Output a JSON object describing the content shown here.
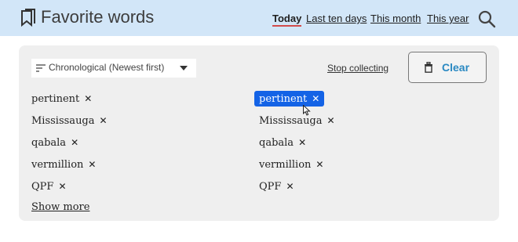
{
  "header": {
    "title": "Favorite words",
    "nav": [
      "Today",
      "Last ten days",
      "This month",
      "This year"
    ],
    "active_nav": "Today",
    "logo_icon": "bookmark-icon",
    "search_icon": "search-icon"
  },
  "controls": {
    "sort_label": "Chronological (Newest first)",
    "stop_label": "Stop collecting",
    "clear_label": "Clear"
  },
  "lists": {
    "left": [
      "pertinent",
      "Mississauga",
      "qabala",
      "vermillion",
      "QPF"
    ],
    "right": [
      "pertinent",
      "Mississauga",
      "qabala",
      "vermillion",
      "QPF"
    ],
    "remove_glyph": "✕",
    "selected_right_index": 0
  },
  "show_more": "Show more",
  "colors": {
    "header_bg": "#d2e6f8",
    "panel_bg": "#efefef",
    "accent": "#2a89c2",
    "selection": "#1463e6",
    "active_underline": "#d24a4a"
  }
}
